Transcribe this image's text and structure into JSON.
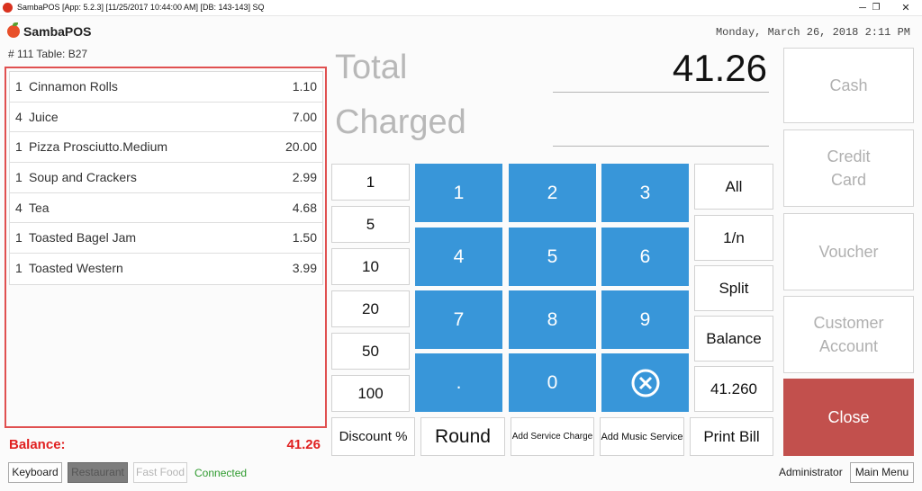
{
  "window": {
    "title": "SambaPOS [App: 5.2.3] [11/25/2017 10:44:00 AM] [DB: 143-143] SQ",
    "minimize": "─",
    "restore": "❐",
    "close": "✕"
  },
  "header": {
    "logo_text": "SambaPOS",
    "ticket_info": "# 111 Table: B27",
    "datetime": "Monday, March 26, 2018 2:11 PM"
  },
  "order": {
    "items": [
      {
        "qty": "1",
        "name": "Cinnamon Rolls",
        "price": "1.10"
      },
      {
        "qty": "4",
        "name": "Juice",
        "price": "7.00"
      },
      {
        "qty": "1",
        "name": "Pizza Prosciutto.Medium",
        "price": "20.00"
      },
      {
        "qty": "1",
        "name": "Soup and Crackers",
        "price": "2.99"
      },
      {
        "qty": "4",
        "name": "Tea",
        "price": "4.68"
      },
      {
        "qty": "1",
        "name": "Toasted Bagel Jam",
        "price": "1.50"
      },
      {
        "qty": "1",
        "name": "Toasted Western",
        "price": "3.99"
      }
    ],
    "balance_label": "Balance:",
    "balance_value": "41.26"
  },
  "status_bar": {
    "keyboard": "Keyboard",
    "restaurant": "Restaurant",
    "fast_food": "Fast Food",
    "connected": "Connected",
    "user": "Administrator",
    "main_menu": "Main Menu"
  },
  "payment": {
    "total_label": "Total",
    "charged_label": "Charged",
    "total_value": "41.26",
    "tender_amounts": [
      "1",
      "5",
      "10",
      "20",
      "50",
      "100"
    ],
    "keypad": [
      "1",
      "2",
      "3",
      "4",
      "5",
      "6",
      "7",
      "8",
      "9",
      ".",
      "0"
    ],
    "split_options": [
      "All",
      "1/n",
      "Split",
      "Balance",
      "41.260"
    ],
    "bottom_actions": {
      "discount": "Discount %",
      "round": "Round",
      "add_service_charge": "Add Service Charge",
      "add_music_service": "Add Music Service",
      "print_bill": "Print Bill"
    },
    "methods": {
      "cash": "Cash",
      "credit_card_line1": "Credit",
      "credit_card_line2": "Card",
      "voucher": "Voucher",
      "customer_account_line1": "Customer",
      "customer_account_line2": "Account",
      "close": "Close"
    }
  },
  "colors": {
    "keypad_blue": "#3896d9",
    "close_red": "#c2504d",
    "balance_red": "#e02020",
    "order_border": "#e05050",
    "connected_green": "#2e9a2e"
  }
}
